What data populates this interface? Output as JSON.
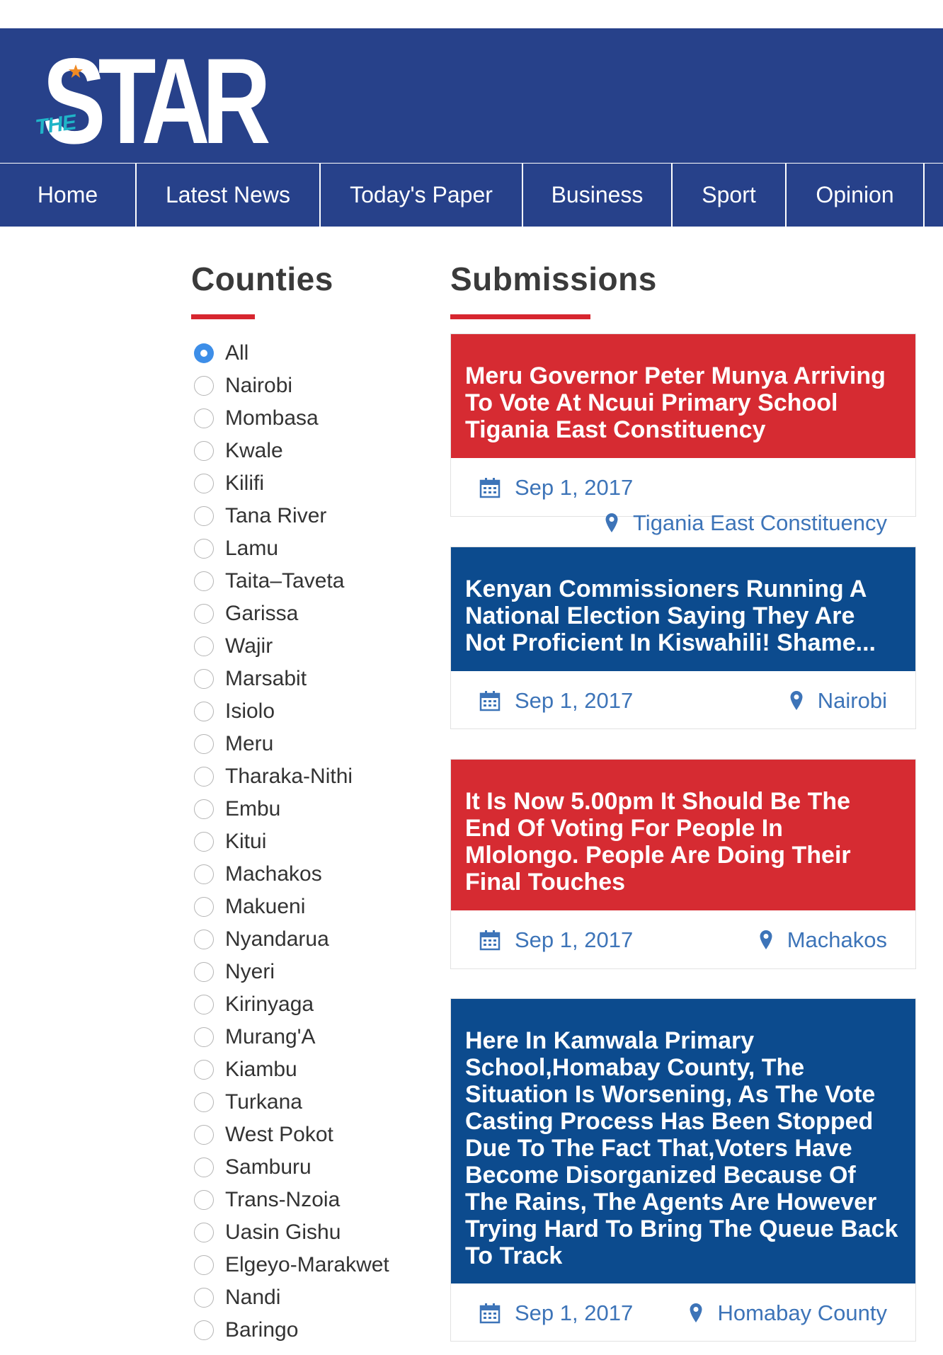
{
  "brand": {
    "logo_the": "THE",
    "logo_star": "STAR",
    "header_color": "#27418a"
  },
  "nav": {
    "items": [
      {
        "label": "Home"
      },
      {
        "label": "Latest News"
      },
      {
        "label": "Today's Paper"
      },
      {
        "label": "Business"
      },
      {
        "label": "Sport"
      },
      {
        "label": "Opinion"
      }
    ]
  },
  "sidebar": {
    "title": "Counties",
    "selected": "All",
    "counties": [
      "All",
      "Nairobi",
      "Mombasa",
      "Kwale",
      "Kilifi",
      "Tana River",
      "Lamu",
      "Taita–Taveta",
      "Garissa",
      "Wajir",
      "Marsabit",
      "Isiolo",
      "Meru",
      "Tharaka-Nithi",
      "Embu",
      "Kitui",
      "Machakos",
      "Makueni",
      "Nyandarua",
      "Nyeri",
      "Kirinyaga",
      "Murang'A",
      "Kiambu",
      "Turkana",
      "West Pokot",
      "Samburu",
      "Trans-Nzoia",
      "Uasin Gishu",
      "Elgeyo-Marakwet",
      "Nandi",
      "Baringo"
    ]
  },
  "submissions": {
    "title": "Submissions",
    "cards": [
      {
        "headline": "Meru Governor Peter Munya Arriving To Vote At Ncuui Primary School Tigania East Constituency",
        "date": "Sep 1, 2017",
        "location": "Tigania East Constituency",
        "color": "red"
      },
      {
        "headline": "Kenyan Commissioners Running A National Election Saying They Are Not Proficient In Kiswahili! Shame...",
        "date": "Sep 1, 2017",
        "location": "Nairobi",
        "color": "blue"
      },
      {
        "headline": "It Is Now 5.00pm It Should Be The End Of Voting For People In Mlolongo. People Are Doing Their Final Touches",
        "date": "Sep 1, 2017",
        "location": "Machakos",
        "color": "red"
      },
      {
        "headline": "Here In Kamwala Primary School,Homabay County, The Situation Is Worsening, As The Vote Casting Process Has Been Stopped Due To The Fact That,Voters Have Become Disorganized Because Of The Rains, The Agents Are However Trying Hard To Bring The Queue Back To Track",
        "date": "Sep 1, 2017",
        "location": "Homabay County",
        "color": "blue"
      }
    ]
  },
  "colors": {
    "accent_red": "#d62b32",
    "card_blue": "#0c4b8e",
    "link_blue": "#3d74b8",
    "radio_selected": "#3d8ee8"
  }
}
